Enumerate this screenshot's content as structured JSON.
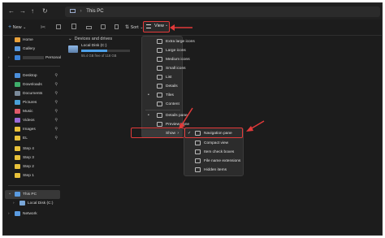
{
  "address": {
    "path": "This PC"
  },
  "nav": {
    "back": "←",
    "forward": "→",
    "up": "↑",
    "refresh": "↻"
  },
  "toolbar": {
    "new_label": "New",
    "sort_label": "Sort",
    "view_label": "View"
  },
  "sidebar": {
    "items": [
      {
        "label": "Home",
        "color": "#e8a13a"
      },
      {
        "label": "Gallery",
        "color": "#5a9be0"
      },
      {
        "label": "Personal",
        "color": "#3a82d8"
      },
      {
        "label": "Desktop",
        "color": "#4b8fdc",
        "pinned": true
      },
      {
        "label": "Downloads",
        "color": "#3fae6b",
        "pinned": true
      },
      {
        "label": "Documents",
        "color": "#7a8a9a",
        "pinned": true
      },
      {
        "label": "Pictures",
        "color": "#4aa0d8",
        "pinned": true
      },
      {
        "label": "Music",
        "color": "#e05a6a",
        "pinned": true
      },
      {
        "label": "Videos",
        "color": "#9a6ad8",
        "pinned": true
      },
      {
        "label": "Images",
        "color": "#e8c13a",
        "pinned": true
      },
      {
        "label": "EL",
        "color": "#e8c13a",
        "pinned": true
      },
      {
        "label": "Step 4",
        "color": "#e8c13a"
      },
      {
        "label": "Step 3",
        "color": "#e8c13a"
      },
      {
        "label": "Step 2",
        "color": "#e8c13a"
      },
      {
        "label": "Step 1",
        "color": "#e8c13a"
      },
      {
        "label": "This PC",
        "color": "#5a9be0"
      },
      {
        "label": "Local Disk (C:)",
        "color": "#7aa7d8"
      },
      {
        "label": "Network",
        "color": "#5a9be0"
      }
    ],
    "pin_glyph": "⚲"
  },
  "main": {
    "section": "Devices and drives",
    "drive": {
      "name": "Local Disk (C:)",
      "free": "55.4 GB free of 118 GB",
      "used_fraction": 0.53
    }
  },
  "view_menu": {
    "items": [
      {
        "label": "Extra large icons"
      },
      {
        "label": "Large icons"
      },
      {
        "label": "Medium icons"
      },
      {
        "label": "Small icons"
      },
      {
        "label": "List"
      },
      {
        "label": "Details"
      },
      {
        "label": "Tiles",
        "checked": true
      },
      {
        "label": "Content"
      },
      {
        "label": "Details pane",
        "checked": true
      },
      {
        "label": "Preview pane"
      },
      {
        "label": "Show",
        "submenu": true
      }
    ]
  },
  "show_menu": {
    "items": [
      {
        "label": "Navigation pane",
        "checked": true
      },
      {
        "label": "Compact view"
      },
      {
        "label": "Item check boxes"
      },
      {
        "label": "File name extensions"
      },
      {
        "label": "Hidden items"
      }
    ]
  },
  "glyphs": {
    "check": "✓",
    "bullet": "•",
    "chevron": "›",
    "chevron_down": "⌄",
    "cut": "✂"
  },
  "colors": {
    "accent": "#e23a3a",
    "background": "#1c1c1c",
    "menu": "#2c2c2c"
  }
}
